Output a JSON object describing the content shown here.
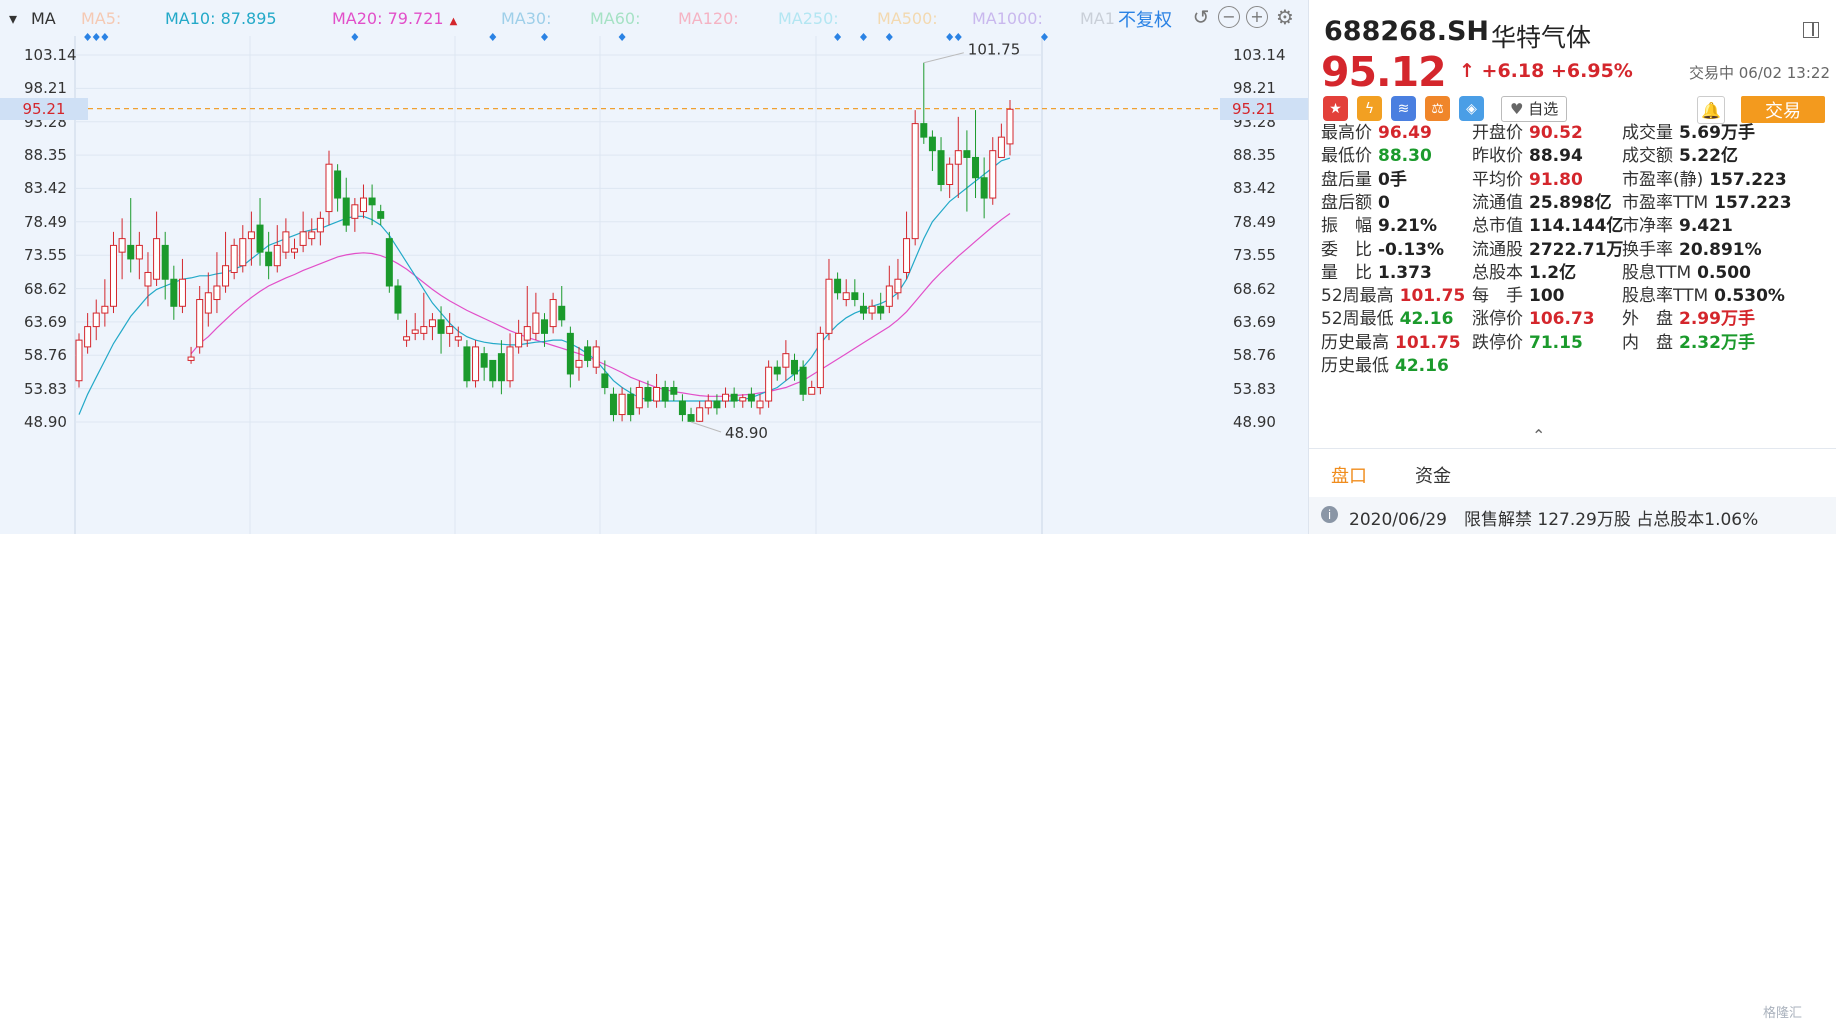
{
  "ma_bar": {
    "label": "MA",
    "items": [
      {
        "name": "MA5:",
        "value": "",
        "color": "#f5c9b3",
        "arrow": ""
      },
      {
        "name": "MA10:",
        "value": "87.895",
        "color": "#23a9c8",
        "arrow": ""
      },
      {
        "name": "MA20:",
        "value": "79.721",
        "color": "#e24fc9",
        "arrow": "▲"
      },
      {
        "name": "MA30:",
        "value": "",
        "color": "#9ecfe9",
        "arrow": ""
      },
      {
        "name": "MA60:",
        "value": "",
        "color": "#a6e2c5",
        "arrow": ""
      },
      {
        "name": "MA120:",
        "value": "",
        "color": "#f5b3c3",
        "arrow": ""
      },
      {
        "name": "MA250:",
        "value": "",
        "color": "#b3e6f2",
        "arrow": ""
      },
      {
        "name": "MA500:",
        "value": "",
        "color": "#f3d9b0",
        "arrow": ""
      },
      {
        "name": "MA1000:",
        "value": "",
        "color": "#c9b8ee",
        "arrow": ""
      },
      {
        "name": "MA1",
        "value": "",
        "color": "#c9cfd8",
        "arrow": ""
      }
    ],
    "adjust_label": "不复权"
  },
  "chart_data": {
    "type": "candlestick",
    "ylim": [
      46.5,
      105.0
    ],
    "y_ticks": [
      "103.14",
      "98.21",
      "93.28",
      "88.35",
      "83.42",
      "78.49",
      "73.55",
      "68.62",
      "63.69",
      "58.76",
      "53.83",
      "48.90"
    ],
    "current_price_label": "95.21",
    "current_price": 95.21,
    "max_label": "101.75",
    "min_label": "48.90",
    "up_color": "#d4262c",
    "down_color": "#1b9a2c",
    "ma10_color": "#23a9c8",
    "ma20_color": "#e24fc9",
    "event_marker_indices": [
      1,
      2,
      3,
      32,
      48,
      54,
      63,
      88,
      91,
      94,
      101,
      102,
      112
    ],
    "candles": [
      [
        55,
        61,
        54,
        62
      ],
      [
        60,
        63,
        59,
        65
      ],
      [
        63,
        65,
        61,
        67
      ],
      [
        65,
        66,
        63,
        70
      ],
      [
        66,
        75,
        65,
        77
      ],
      [
        74,
        76,
        70,
        79
      ],
      [
        75,
        73,
        71,
        82
      ],
      [
        73,
        75,
        70,
        77
      ],
      [
        69,
        71,
        66,
        74
      ],
      [
        70,
        76,
        69,
        80
      ],
      [
        75,
        70,
        67,
        77
      ],
      [
        70,
        66,
        64,
        72
      ],
      [
        66,
        70,
        65,
        73
      ],
      [
        58,
        58.5,
        57.5,
        60
      ],
      [
        60,
        67,
        59,
        69
      ],
      [
        65,
        68,
        63,
        71
      ],
      [
        67,
        69,
        65,
        74
      ],
      [
        69,
        72,
        68,
        77
      ],
      [
        71,
        75,
        70,
        76
      ],
      [
        72,
        76,
        71,
        78
      ],
      [
        76,
        77,
        72,
        80
      ],
      [
        78,
        74,
        72,
        82
      ],
      [
        74,
        72,
        70,
        77
      ],
      [
        72,
        75,
        71,
        78
      ],
      [
        74,
        77,
        73,
        79
      ],
      [
        74,
        74.5,
        73,
        76
      ],
      [
        75,
        77,
        74,
        80
      ],
      [
        76,
        77,
        75,
        79
      ],
      [
        77,
        79,
        75,
        80
      ],
      [
        80,
        87,
        78,
        89
      ],
      [
        86,
        82,
        80,
        87
      ],
      [
        82,
        78,
        77,
        85
      ],
      [
        79,
        81,
        77,
        82
      ],
      [
        80,
        82,
        79,
        84
      ],
      [
        82,
        81,
        78,
        84
      ],
      [
        80,
        79,
        78,
        81
      ],
      [
        76,
        69,
        68,
        77
      ],
      [
        69,
        65,
        64,
        70
      ],
      [
        61,
        61.5,
        60,
        64
      ],
      [
        62,
        62.5,
        61,
        65
      ],
      [
        62,
        63,
        61,
        68
      ],
      [
        63,
        64,
        61,
        65
      ],
      [
        64,
        62,
        59,
        66
      ],
      [
        62,
        63,
        60,
        65
      ],
      [
        61,
        61.5,
        60,
        63
      ],
      [
        60,
        55,
        54,
        61
      ],
      [
        55,
        60,
        54,
        61
      ],
      [
        59,
        57,
        55,
        60
      ],
      [
        58,
        55,
        54,
        58
      ],
      [
        59,
        55,
        53,
        61
      ],
      [
        55,
        60,
        54,
        62
      ],
      [
        60,
        62,
        59,
        64
      ],
      [
        61,
        63,
        60,
        69
      ],
      [
        62,
        65,
        61,
        68
      ],
      [
        64,
        62,
        60,
        65
      ],
      [
        63,
        67,
        62,
        68
      ],
      [
        66,
        64,
        63,
        69
      ],
      [
        62,
        56,
        54,
        63
      ],
      [
        57,
        58,
        55,
        60
      ],
      [
        60,
        58,
        57,
        61
      ],
      [
        57,
        60,
        56,
        61
      ],
      [
        56,
        54,
        53,
        58
      ],
      [
        53,
        50,
        49,
        54
      ],
      [
        50,
        53,
        49,
        54
      ],
      [
        53,
        50,
        49,
        54
      ],
      [
        51,
        54,
        50,
        55
      ],
      [
        54,
        52,
        51,
        55
      ],
      [
        52,
        54,
        51,
        56
      ],
      [
        54,
        52,
        51,
        55
      ],
      [
        54,
        53,
        52,
        55
      ],
      [
        52,
        50,
        49,
        53
      ],
      [
        50,
        49,
        48.9,
        51
      ],
      [
        49,
        51,
        48.9,
        52
      ],
      [
        51,
        52,
        50,
        53
      ],
      [
        52,
        51,
        50,
        53
      ],
      [
        52,
        53,
        51,
        54
      ],
      [
        53,
        52,
        51,
        54
      ],
      [
        52,
        52.5,
        51,
        53
      ],
      [
        53,
        52,
        51,
        54
      ],
      [
        51,
        52,
        50,
        53
      ],
      [
        52,
        57,
        51,
        58
      ],
      [
        57,
        56,
        55,
        58
      ],
      [
        57,
        59,
        55,
        61
      ],
      [
        58,
        56,
        55,
        59
      ],
      [
        57,
        53,
        52,
        58
      ],
      [
        53,
        54,
        53,
        55
      ],
      [
        54,
        62,
        53,
        63
      ],
      [
        62,
        70,
        61,
        73
      ],
      [
        70,
        68,
        67,
        71
      ],
      [
        67,
        68,
        66,
        70
      ],
      [
        68,
        67,
        66,
        70
      ],
      [
        66,
        65,
        64,
        68
      ],
      [
        65,
        66,
        64,
        67
      ],
      [
        66,
        65,
        64,
        68
      ],
      [
        66,
        69,
        65,
        72
      ],
      [
        68,
        70,
        67,
        73
      ],
      [
        71,
        76,
        70,
        80
      ],
      [
        76,
        93,
        75,
        95
      ],
      [
        93,
        91,
        90,
        102
      ],
      [
        91,
        89,
        86,
        92
      ],
      [
        89,
        84,
        83,
        91
      ],
      [
        84,
        87,
        82,
        88
      ],
      [
        87,
        89,
        82,
        94
      ],
      [
        89,
        88,
        80,
        92
      ],
      [
        88,
        85,
        82,
        95
      ],
      [
        85,
        82,
        79,
        88
      ],
      [
        82,
        89,
        81,
        91
      ],
      [
        88,
        91,
        89,
        93
      ],
      [
        90,
        95.12,
        88.3,
        96.49
      ]
    ],
    "ma10": [
      50,
      53,
      55.5,
      58,
      60.5,
      62.5,
      64.5,
      66,
      67.5,
      68.5,
      69,
      69.5,
      70,
      70.2,
      70.5,
      70.5,
      70.8,
      71,
      71.5,
      72,
      73,
      74,
      75,
      75.5,
      76,
      76.5,
      77,
      77.3,
      77.5,
      78,
      78.5,
      79,
      79.3,
      79.3,
      78.8,
      78,
      76.5,
      74.5,
      72.5,
      70.5,
      68.5,
      66.5,
      65,
      63.5,
      62.3,
      61.5,
      61,
      60.7,
      60.5,
      60.4,
      60.3,
      60.3,
      60.5,
      60.7,
      60.8,
      61,
      61,
      60.5,
      59.8,
      59,
      58,
      56.5,
      55,
      54,
      53.2,
      52.5,
      52.2,
      52,
      52,
      52,
      52,
      52,
      52,
      52,
      52,
      52,
      52,
      52.2,
      52.5,
      53,
      53.5,
      54,
      55,
      56,
      57,
      58.5,
      60.5,
      62,
      63.3,
      64.3,
      65,
      65.5,
      66,
      66.4,
      67,
      68,
      70,
      73,
      76,
      78.5,
      80,
      81.5,
      82.5,
      83.5,
      84.5,
      85.5,
      86.5,
      87.5,
      87.9
    ],
    "ma20": [
      null,
      null,
      null,
      null,
      null,
      null,
      null,
      null,
      null,
      null,
      null,
      null,
      null,
      59,
      60.5,
      61.5,
      62.8,
      64,
      65.2,
      66.3,
      67.3,
      68.2,
      69,
      69.6,
      70.2,
      70.7,
      71.3,
      71.8,
      72.3,
      72.8,
      73.3,
      73.6,
      73.8,
      73.9,
      73.8,
      73.5,
      73,
      72.3,
      71.5,
      70.5,
      69.5,
      68.5,
      67.6,
      66.8,
      66.1,
      65.4,
      64.8,
      64.2,
      63.6,
      63,
      62.4,
      61.9,
      61.4,
      61,
      60.6,
      60.2,
      59.8,
      59.4,
      59,
      58.5,
      58,
      57.4,
      56.8,
      56.2,
      55.5,
      55,
      54.5,
      54,
      53.7,
      53.4,
      53.2,
      53,
      52.8,
      52.7,
      52.7,
      52.7,
      52.8,
      52.9,
      53,
      53.2,
      53.4,
      53.7,
      54,
      54.5,
      55,
      55.8,
      56.6,
      57.4,
      58.2,
      59,
      59.8,
      60.6,
      61.4,
      62.2,
      63,
      64,
      65.2,
      66.7,
      68.2,
      69.7,
      71,
      72.2,
      73.4,
      74.5,
      75.6,
      76.7,
      77.8,
      78.8,
      79.72
    ]
  },
  "stock": {
    "code": "688268.SH",
    "name": "华特气体",
    "price": "95.12",
    "arrow": "↑",
    "change": "+6.18",
    "change_pct": "+6.95%",
    "status": "交易中 06/02 13:22",
    "watch_label": "自选",
    "trade_label": "交易"
  },
  "badges": [
    {
      "icon": "cn-flag-icon",
      "glyph": "★",
      "color": "#e3403a"
    },
    {
      "icon": "lightning-icon",
      "glyph": "ϟ",
      "color": "#f2a022"
    },
    {
      "icon": "database-icon",
      "glyph": "≋",
      "color": "#4a7fe0"
    },
    {
      "icon": "scale-icon",
      "glyph": "⚖",
      "color": "#f0862a"
    },
    {
      "icon": "tag-icon",
      "glyph": "◈",
      "color": "#4a9ee6"
    }
  ],
  "stats": {
    "col1": [
      {
        "k": "最高价",
        "v": "96.49",
        "c": "red"
      },
      {
        "k": "最低价",
        "v": "88.30",
        "c": "green"
      },
      {
        "k": "盘后量",
        "v": "0手",
        "c": "dark"
      },
      {
        "k": "盘后额",
        "v": "0",
        "c": "dark"
      },
      {
        "k": "振　幅",
        "v": "9.21%",
        "c": "dark"
      },
      {
        "k": "委　比",
        "v": "-0.13%",
        "c": "dark"
      },
      {
        "k": "量　比",
        "v": "1.373",
        "c": "dark"
      },
      {
        "k": "52周最高",
        "v": "101.75",
        "c": "red"
      },
      {
        "k": "52周最低",
        "v": "42.16",
        "c": "green"
      },
      {
        "k": "历史最高",
        "v": "101.75",
        "c": "red"
      },
      {
        "k": "历史最低",
        "v": "42.16",
        "c": "green"
      }
    ],
    "col2": [
      {
        "k": "开盘价",
        "v": "90.52",
        "c": "red"
      },
      {
        "k": "昨收价",
        "v": "88.94",
        "c": "dark"
      },
      {
        "k": "平均价",
        "v": "91.80",
        "c": "red"
      },
      {
        "k": "流通值",
        "v": "25.898亿",
        "c": "dark"
      },
      {
        "k": "总市值",
        "v": "114.144亿",
        "c": "dark"
      },
      {
        "k": "流通股",
        "v": "2722.71万",
        "c": "dark"
      },
      {
        "k": "总股本",
        "v": "1.2亿",
        "c": "dark"
      },
      {
        "k": "每　手",
        "v": "100",
        "c": "dark"
      },
      {
        "k": "涨停价",
        "v": "106.73",
        "c": "red"
      },
      {
        "k": "跌停价",
        "v": "71.15",
        "c": "green"
      }
    ],
    "col3": [
      {
        "k": "成交量",
        "v": "5.69万手",
        "c": "dark"
      },
      {
        "k": "成交额",
        "v": "5.22亿",
        "c": "dark"
      },
      {
        "k": "市盈率(静)",
        "v": "157.223",
        "c": "dark"
      },
      {
        "k": "市盈率TTM",
        "v": "157.223",
        "c": "dark"
      },
      {
        "k": "市净率",
        "v": "9.421",
        "c": "dark"
      },
      {
        "k": "换手率",
        "v": "20.891%",
        "c": "dark"
      },
      {
        "k": "股息TTM",
        "v": "0.500",
        "c": "dark"
      },
      {
        "k": "股息率TTM",
        "v": "0.530%",
        "c": "dark"
      },
      {
        "k": "外　盘",
        "v": "2.99万手",
        "c": "red"
      },
      {
        "k": "内　盘",
        "v": "2.32万手",
        "c": "green"
      }
    ]
  },
  "tabs": [
    "盘口",
    "资金"
  ],
  "notice": "2020/06/29　限售解禁 127.29万股 占总股本1.06%",
  "watermark": "格隆汇"
}
